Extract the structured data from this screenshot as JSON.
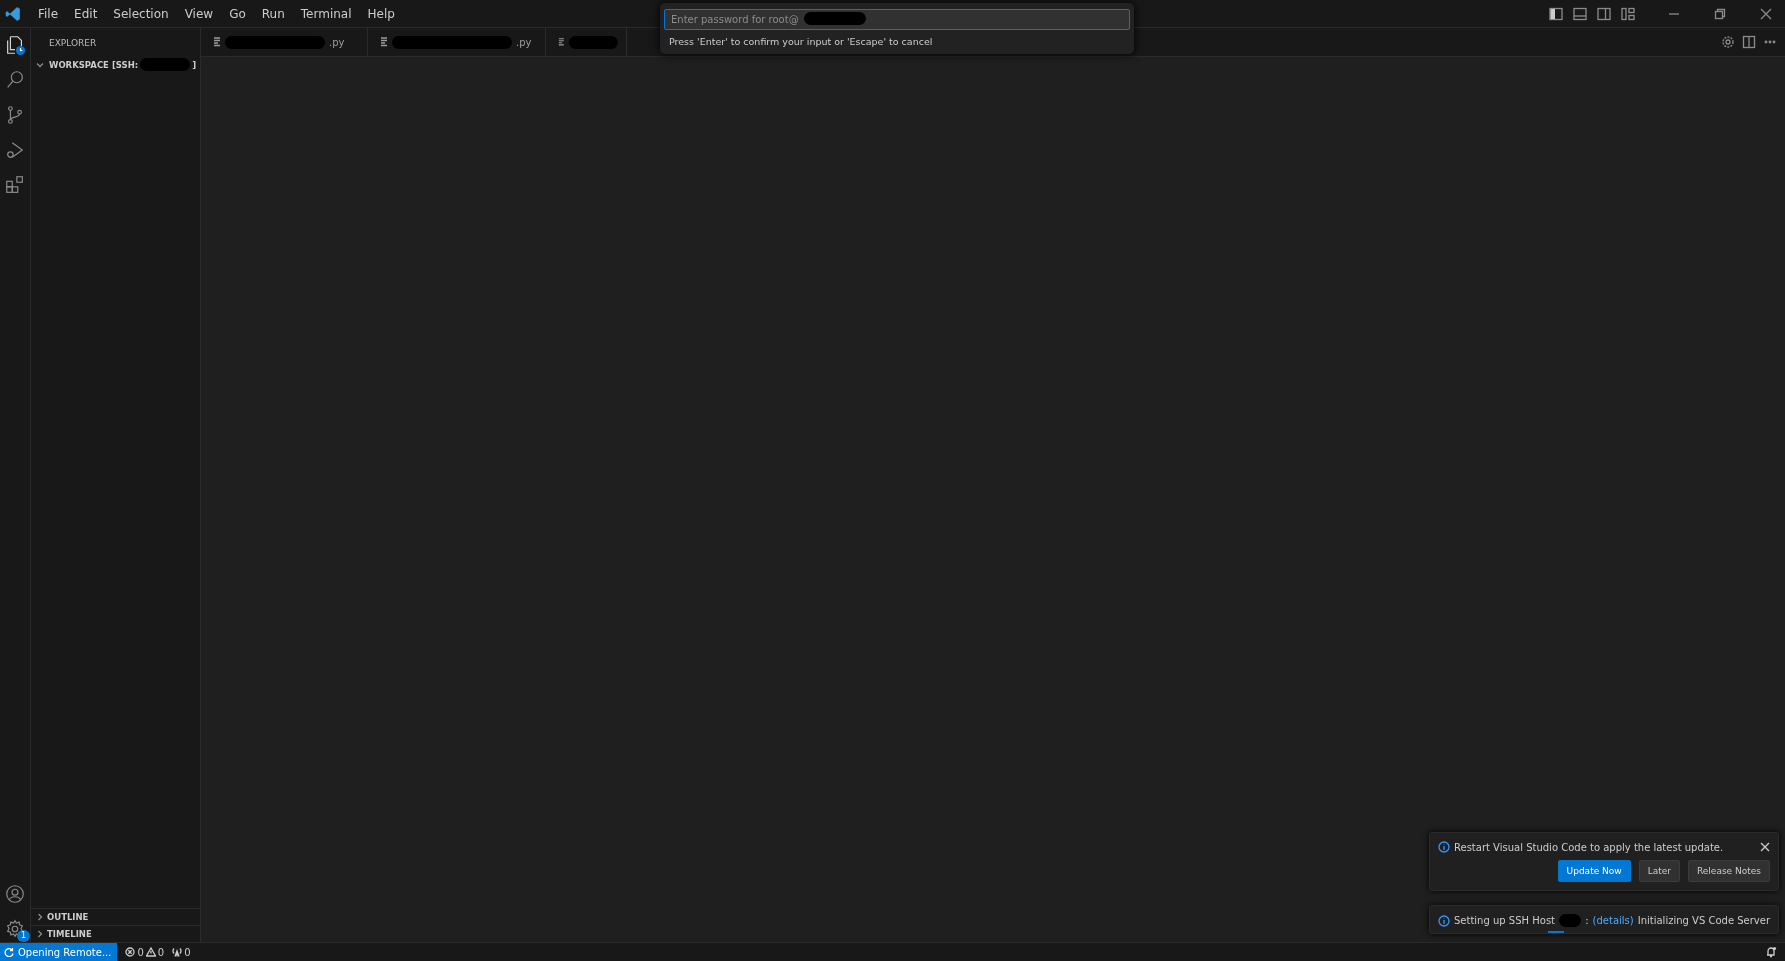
{
  "menu": [
    "File",
    "Edit",
    "Selection",
    "View",
    "Go",
    "Run",
    "Terminal",
    "Help"
  ],
  "sidebar": {
    "title": "EXPLORER",
    "workspace": {
      "label": "WORKSPACE [SSH:",
      "suffix": "]",
      "expanded": true
    },
    "sections": [
      {
        "label": "OUTLINE",
        "expanded": false
      },
      {
        "label": "TIMELINE",
        "expanded": false
      }
    ]
  },
  "tabs": [
    {
      "label": ".py"
    },
    {
      "label": ".py"
    },
    {
      "kind": "partial"
    }
  ],
  "quick_input": {
    "placeholder": "Enter password for root@",
    "message": "Press 'Enter' to confirm your input or 'Escape' to cancel"
  },
  "settings_badge": "1",
  "notifications": [
    {
      "message": "Restart Visual Studio Code to apply the latest update.",
      "buttons": [
        {
          "label": "Update Now",
          "primary": true
        },
        {
          "label": "Later",
          "primary": false
        },
        {
          "label": "Release Notes",
          "primary": false
        }
      ]
    },
    {
      "message": "Setting up SSH Host",
      "separator": ":",
      "link": "(details)",
      "tail": "Initializing VS Code Server"
    }
  ],
  "status_bar": {
    "remote": "Opening Remote...",
    "errors": "0",
    "warnings": "0",
    "ports": "0"
  }
}
